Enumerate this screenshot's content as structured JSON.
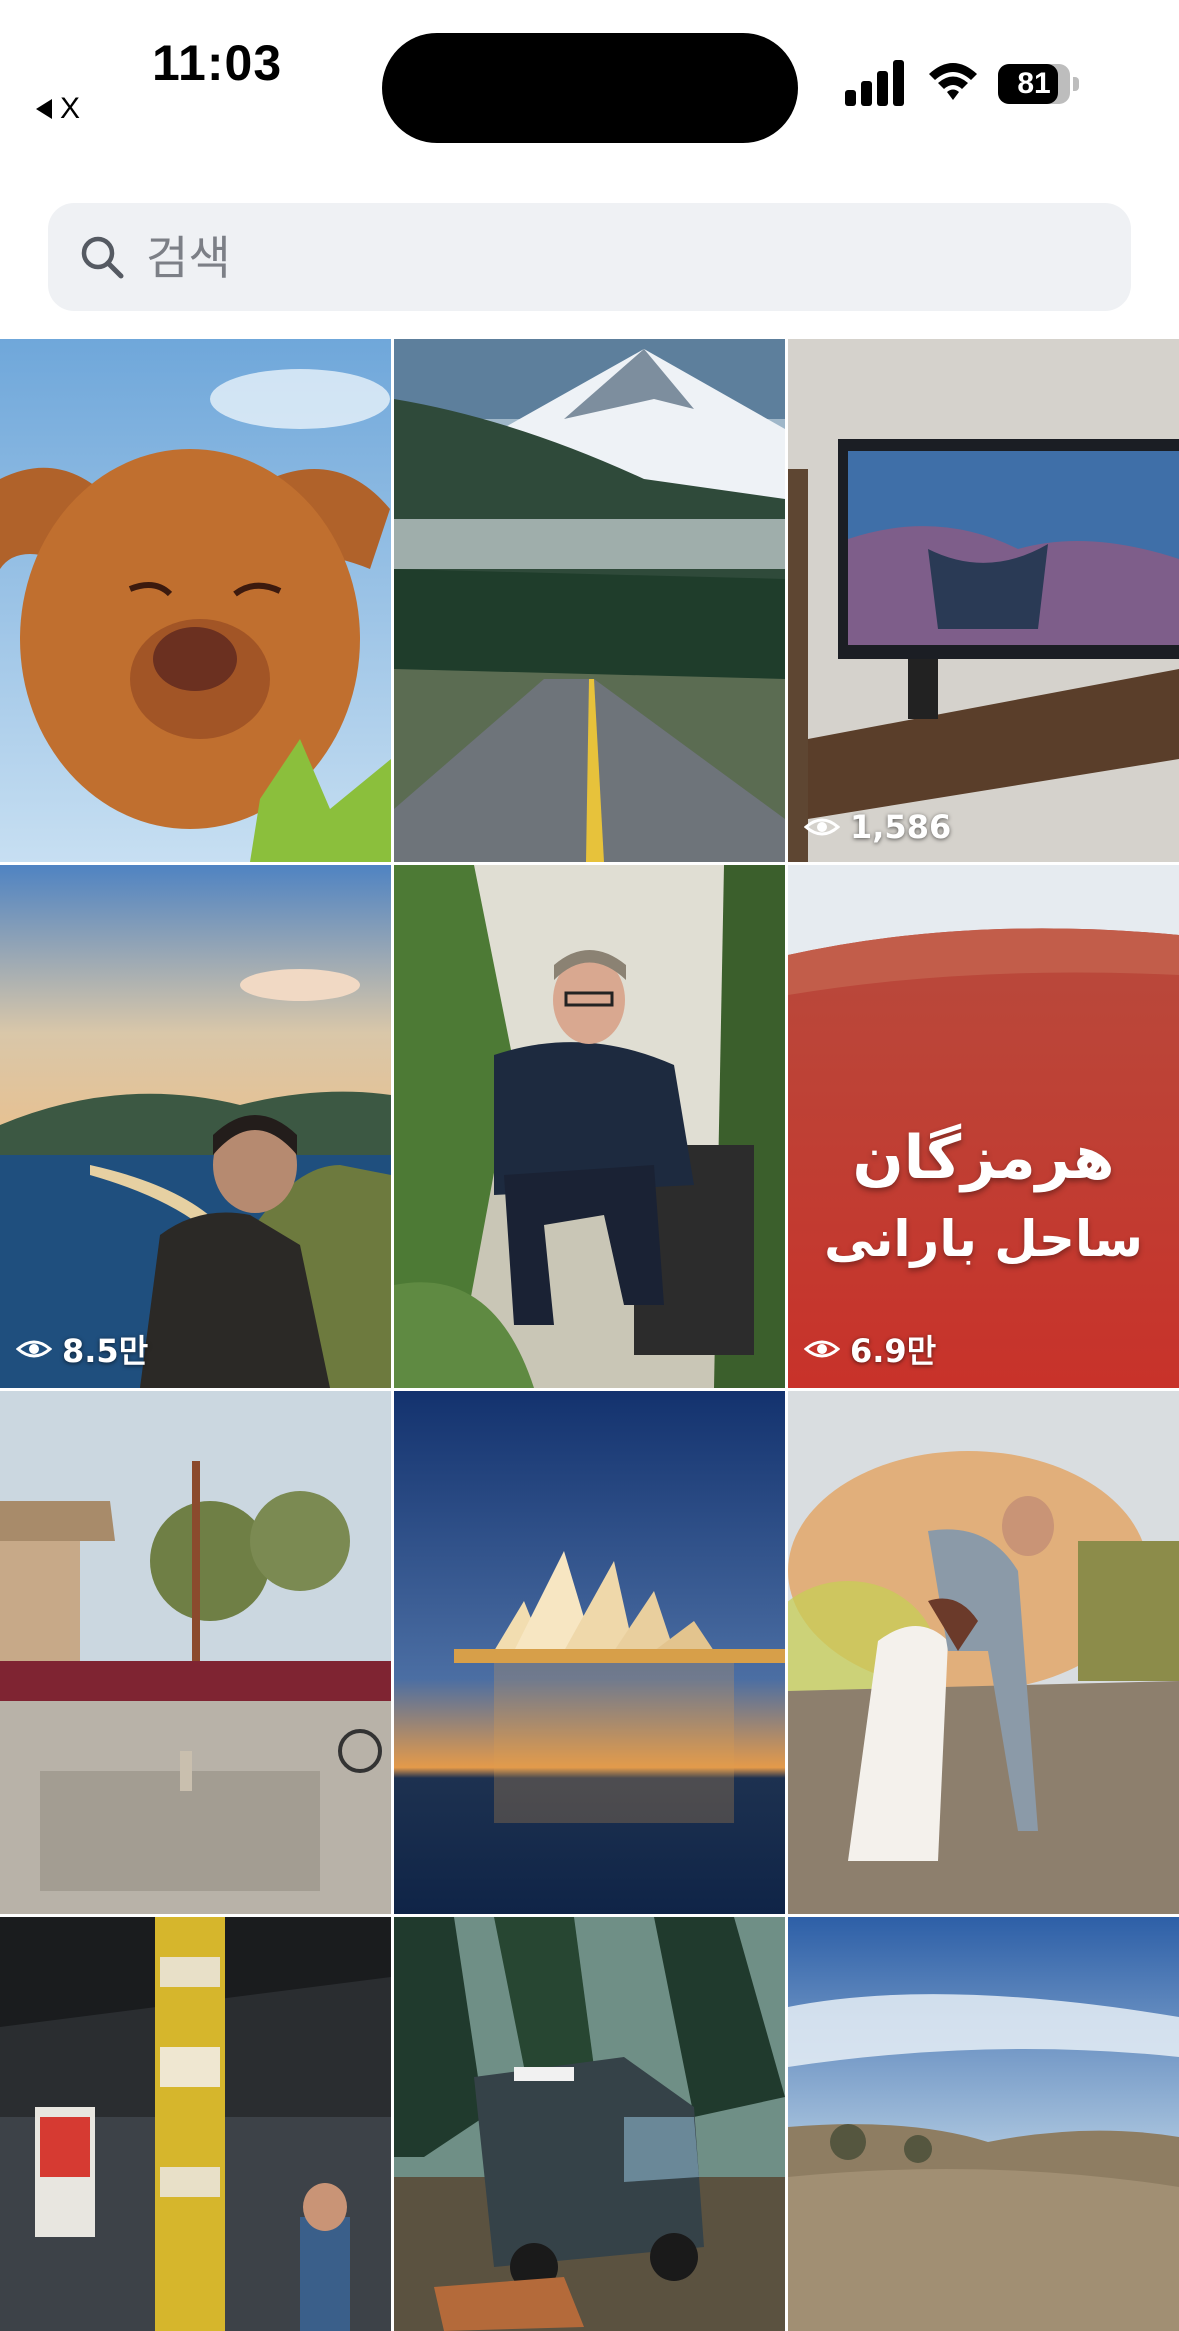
{
  "status_bar": {
    "time": "11:03",
    "back_app_label": "X",
    "battery_level": "81"
  },
  "search": {
    "placeholder": "검색"
  },
  "grid": {
    "tiles": [
      {
        "subject": "dog",
        "views": ""
      },
      {
        "subject": "mountain-road",
        "views": ""
      },
      {
        "subject": "tv-room",
        "views": "1,586"
      },
      {
        "subject": "coast-man",
        "views": "8.5만"
      },
      {
        "subject": "man-sitting",
        "views": ""
      },
      {
        "subject": "red-desert",
        "views": "6.9만",
        "overlay_line1": "هرمزگان",
        "overlay_line2": "ساحل بارانی"
      },
      {
        "subject": "plaza",
        "views": ""
      },
      {
        "subject": "opera-house",
        "views": ""
      },
      {
        "subject": "wedding-couple",
        "views": ""
      },
      {
        "subject": "street-pillar",
        "views": ""
      },
      {
        "subject": "camper-van",
        "views": ""
      },
      {
        "subject": "hills-sky",
        "views": ""
      }
    ]
  },
  "colors": {
    "search_bg": "#eff1f4",
    "placeholder": "#7c7f86"
  },
  "icons": [
    "back-triangle-icon",
    "cellular-signal-icon",
    "wifi-icon",
    "battery-icon",
    "search-icon",
    "eye-icon"
  ]
}
